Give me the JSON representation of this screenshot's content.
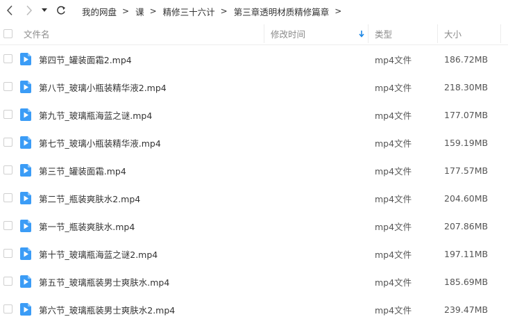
{
  "breadcrumb": {
    "items": [
      "我的网盘",
      "课",
      "精修三十六计",
      "第三章透明材质精修篇章"
    ],
    "separator": ">"
  },
  "columns": {
    "name": "文件名",
    "modified": "修改时间",
    "type": "类型",
    "size": "大小"
  },
  "sort": {
    "column": "modified",
    "direction": "descending",
    "icon": "arrow-down-icon"
  },
  "colors": {
    "accent": "#1e88e5",
    "file_icon": "#3b9cf6",
    "border": "#ececec"
  },
  "files": [
    {
      "name": "第四节_罐装面霜2.mp4",
      "type": "mp4文件",
      "size": "186.72MB"
    },
    {
      "name": "第八节_玻璃小瓶装精华液2.mp4",
      "type": "mp4文件",
      "size": "218.30MB"
    },
    {
      "name": "第九节_玻璃瓶海蓝之谜.mp4",
      "type": "mp4文件",
      "size": "177.07MB"
    },
    {
      "name": "第七节_玻璃小瓶装精华液.mp4",
      "type": "mp4文件",
      "size": "159.19MB"
    },
    {
      "name": "第三节_罐装面霜.mp4",
      "type": "mp4文件",
      "size": "177.57MB"
    },
    {
      "name": "第二节_瓶装爽肤水2.mp4",
      "type": "mp4文件",
      "size": "204.60MB"
    },
    {
      "name": "第一节_瓶装爽肤水.mp4",
      "type": "mp4文件",
      "size": "207.86MB"
    },
    {
      "name": "第十节_玻璃瓶海蓝之谜2.mp4",
      "type": "mp4文件",
      "size": "197.11MB"
    },
    {
      "name": "第五节_玻璃瓶装男士爽肤水.mp4",
      "type": "mp4文件",
      "size": "185.69MB"
    },
    {
      "name": "第六节_玻璃瓶装男士爽肤水2.mp4",
      "type": "mp4文件",
      "size": "239.47MB"
    }
  ]
}
